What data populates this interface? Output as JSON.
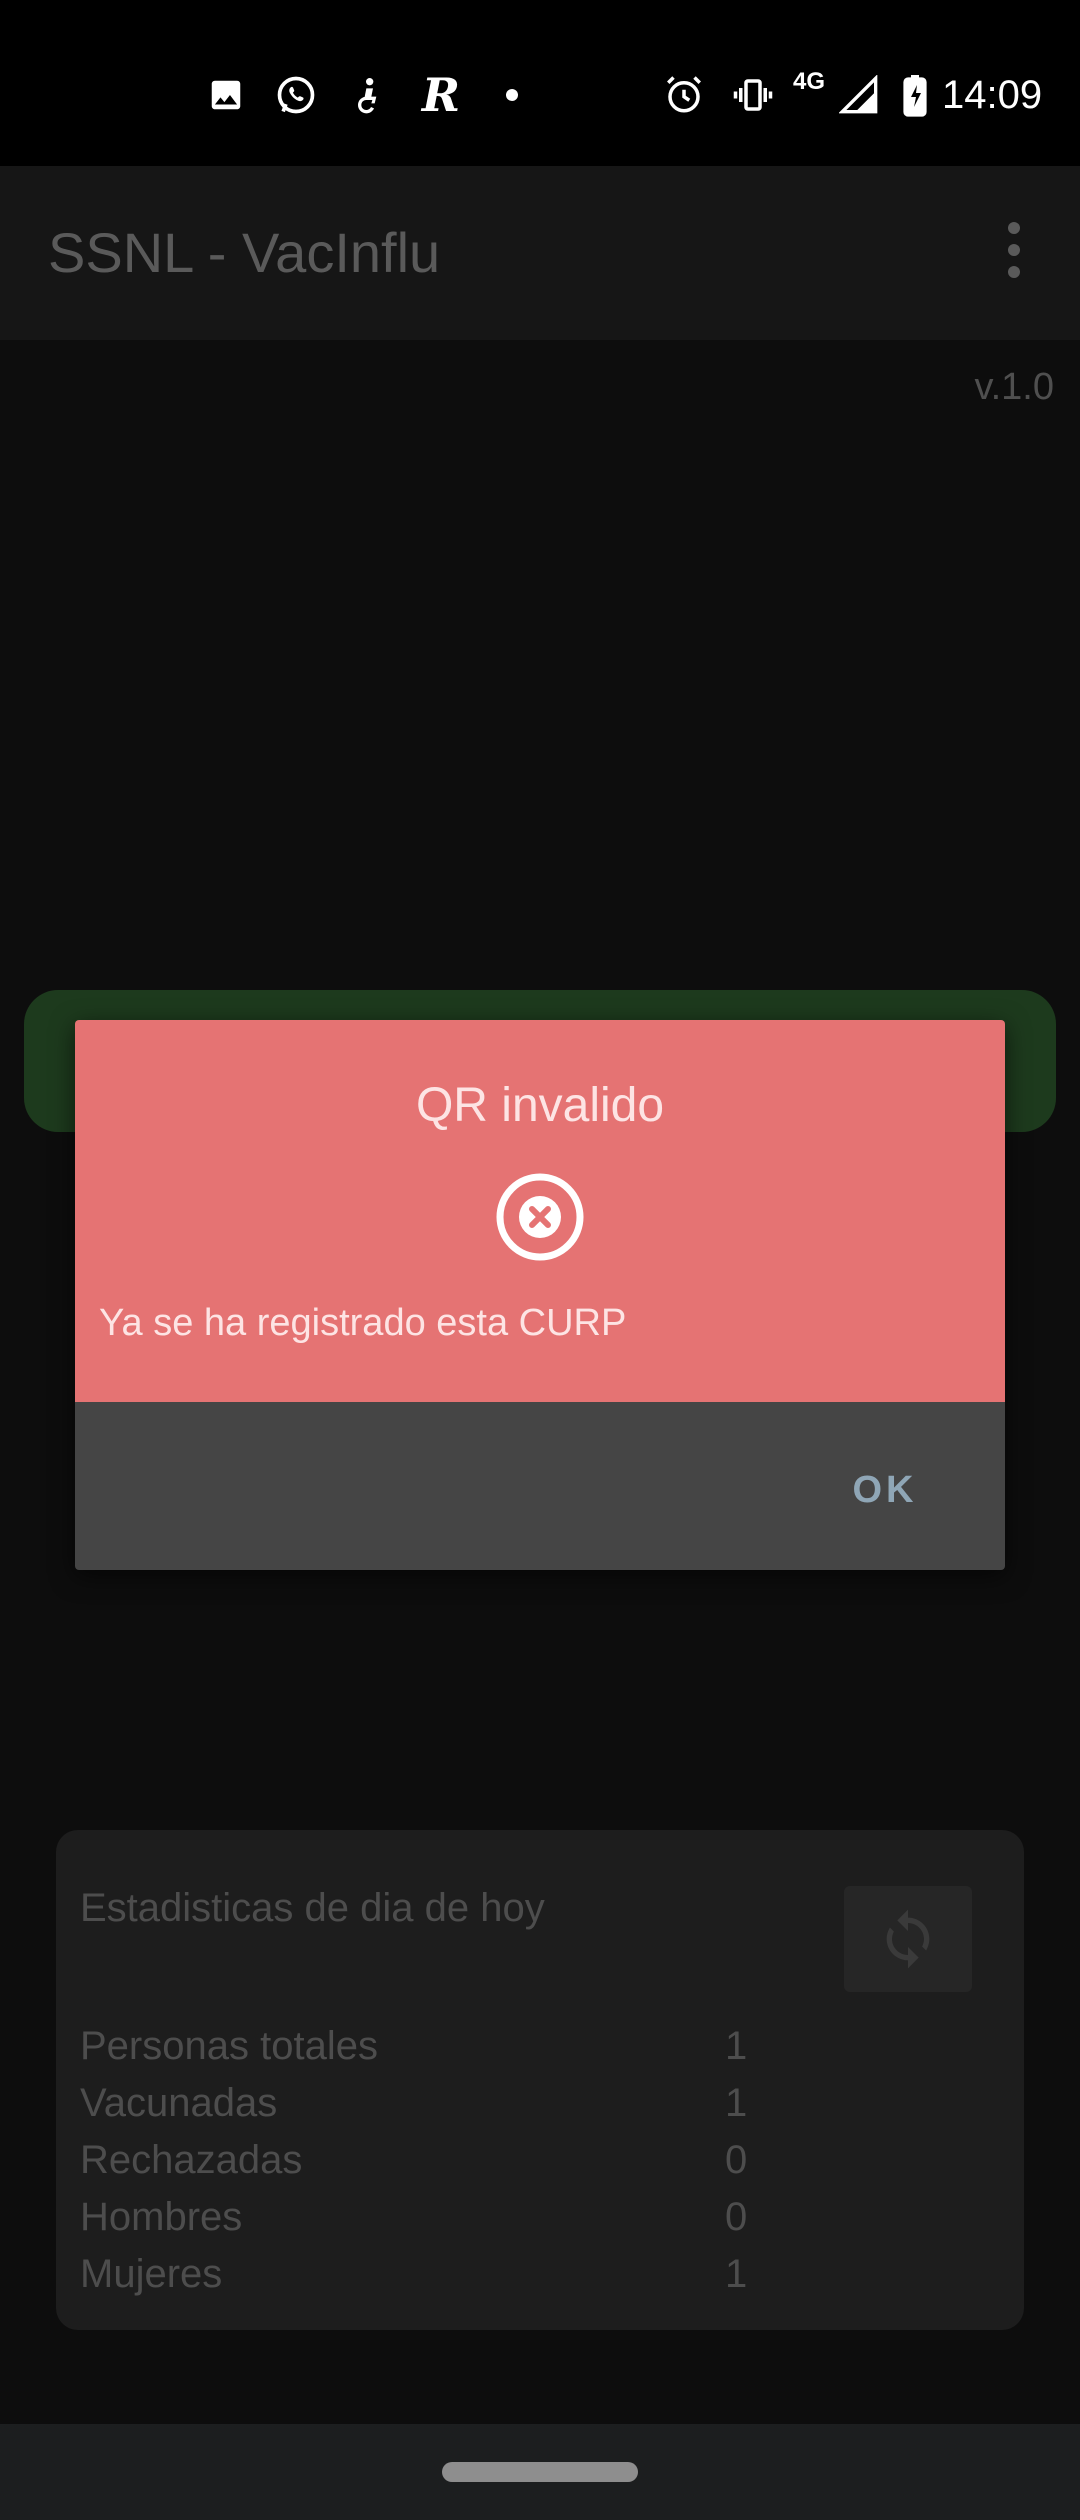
{
  "status_bar": {
    "time": "14:09",
    "network": "4G",
    "icons": [
      "image-icon",
      "whatsapp-icon",
      "accessibility-icon",
      "r-app-icon",
      "dot-icon",
      "alarm-icon",
      "vibrate-icon",
      "signal-icon",
      "battery-charging-icon"
    ]
  },
  "app_bar": {
    "title": "SSNL - VacInflu"
  },
  "main": {
    "version": "v.1.0"
  },
  "stats": {
    "title": "Estadisticas de dia de hoy",
    "rows": [
      {
        "label": "Personas totales",
        "value": "1"
      },
      {
        "label": "Vacunadas",
        "value": "1"
      },
      {
        "label": "Rechazadas",
        "value": "0"
      },
      {
        "label": "Hombres",
        "value": "0"
      },
      {
        "label": "Mujeres",
        "value": "1"
      }
    ]
  },
  "dialog": {
    "title": "QR invalido",
    "message": "Ya se ha registrado esta CURP",
    "ok_label": "OK"
  },
  "colors": {
    "dialog_header": "#e57373",
    "dialog_footer": "#454545",
    "ok_text": "#8fa6b6",
    "banner": "#1d3a1d"
  }
}
